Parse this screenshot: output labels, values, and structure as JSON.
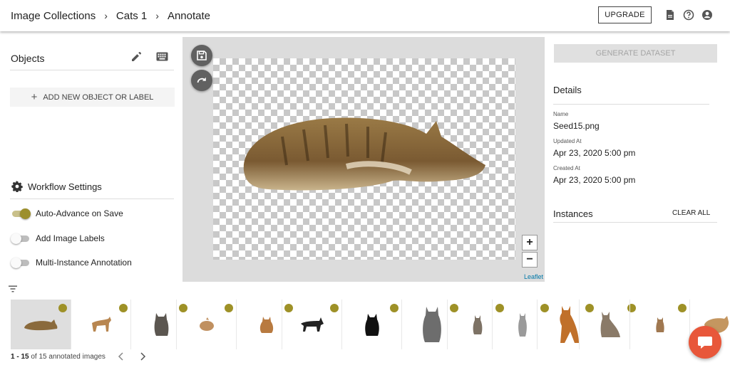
{
  "header": {
    "breadcrumbs": [
      "Image Collections",
      "Cats 1",
      "Annotate"
    ],
    "separator": "›",
    "upgrade_label": "UPGRADE",
    "icons": [
      "document-icon",
      "help-icon",
      "account-icon"
    ]
  },
  "objects_panel": {
    "title": "Objects",
    "add_label": "ADD NEW OBJECT OR LABEL",
    "workflow_title": "Workflow Settings",
    "toggles": [
      {
        "label": "Auto-Advance on Save",
        "on": true
      },
      {
        "label": "Add Image Labels",
        "on": false
      },
      {
        "label": "Multi-Instance Annotation",
        "on": false
      }
    ]
  },
  "canvas": {
    "zoom_in": "+",
    "zoom_out": "−",
    "attribution": "Leaflet"
  },
  "details_panel": {
    "generate_label": "GENERATE DATASET",
    "title": "Details",
    "name_label": "Name",
    "name_value": "Seed15.png",
    "updated_label": "Updated At",
    "updated_value": "Apr 23, 2020 5:00 pm",
    "created_label": "Created At",
    "created_value": "Apr 23, 2020 5:00 pm",
    "instances_title": "Instances",
    "clear_all_label": "CLEAR ALL"
  },
  "image_strip": {
    "pager_range": "1 - 15",
    "pager_rest": " of 15 annotated images",
    "annotated_color": "#9e9127"
  },
  "colors": {
    "accent": "#9e9127",
    "chat": "#e8573a",
    "link": "#0078a8"
  }
}
